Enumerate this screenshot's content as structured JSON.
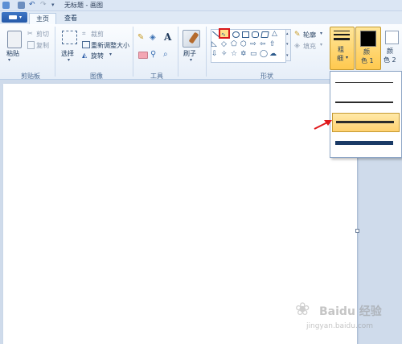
{
  "window": {
    "title": "无标题 - 画图"
  },
  "tabs": [
    {
      "label": "主页",
      "active": true
    },
    {
      "label": "查看",
      "active": false
    }
  ],
  "ribbon": {
    "clipboard": {
      "paste": "粘贴",
      "cut": "剪切",
      "copy": "复制",
      "group": "剪贴板"
    },
    "image": {
      "select": "选择",
      "crop": "裁剪",
      "resize": "重新调整大小",
      "rotate": "旋转",
      "group": "图像"
    },
    "tools": {
      "group": "工具",
      "text_tool": "A"
    },
    "brushes": {
      "label": "刷子"
    },
    "shapes": {
      "outline": "轮廓",
      "fill": "填充",
      "group": "形状"
    },
    "size": {
      "label_line1": "粗",
      "label_line2": "细"
    },
    "color1": {
      "label_line1": "颜",
      "label_line2": "色 1"
    },
    "color2": {
      "label_line1": "颜",
      "label_line2": "色 2"
    }
  },
  "size_dropdown": {
    "options": [
      "1px",
      "3px",
      "5px",
      "8px"
    ],
    "selected_index": 2
  },
  "colors": {
    "accent": "#ffc94f",
    "canvas": "#ffffff",
    "annotation": "#e0181b"
  },
  "watermark": {
    "line1": "Baidu 经验",
    "line2": "jingyan.baidu.com"
  }
}
